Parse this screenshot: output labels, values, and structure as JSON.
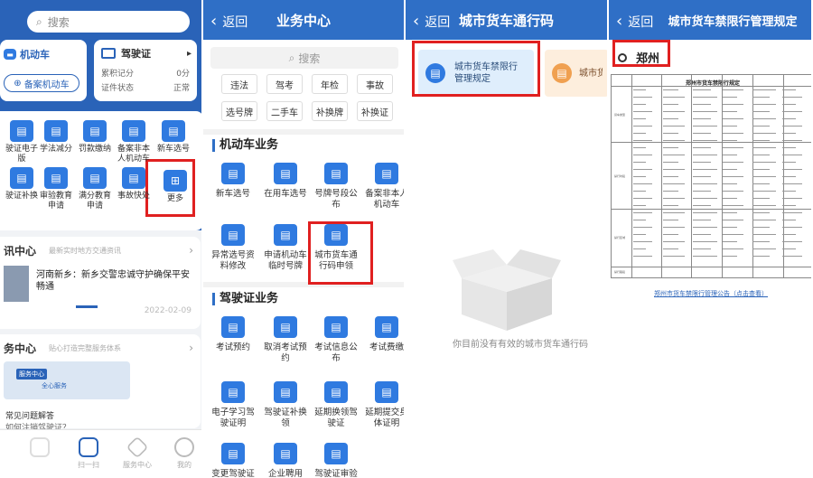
{
  "screen1": {
    "search_placeholder": "搜索",
    "vehicle_label": "机动车",
    "register_vehicle": "备案机动车",
    "license_label": "驾驶证",
    "points_label": "累积记分",
    "points_value": "0分",
    "status_label": "证件状态",
    "status_value": "正常",
    "grid": [
      "驶证电子版",
      "学法减分",
      "罚款缴纳",
      "备案非本人机动车",
      "新车选号",
      "驶证补换",
      "审验教育申请",
      "满分教育申请",
      "事故快处",
      "更多"
    ],
    "news_title": "讯中心",
    "news_sub": "最新实时地方交通资讯",
    "news_item": "河南新乡：新乡交警忠诚守护确保平安畅通",
    "news_date": "2022-02-09",
    "service_title": "务中心",
    "service_sub": "贴心打造完整服务体系",
    "service_badge": "服务中心",
    "service_badge2": "全心服务",
    "faq": "常见问题解答",
    "faq2": "如何注销驾驶证？",
    "tabs": [
      "",
      "扫一扫",
      "服务中心",
      "我的"
    ]
  },
  "screen2": {
    "back": "返回",
    "title": "业务中心",
    "search_placeholder": "搜索",
    "chips": [
      "违法",
      "驾考",
      "年检",
      "事故",
      "选号牌",
      "二手车",
      "补换牌",
      "补换证"
    ],
    "section_vehicle": "机动车业务",
    "vehicle_items": [
      "新车选号",
      "在用车选号",
      "号牌号段公布",
      "备案非本人机动车",
      "异常选号资料修改",
      "申请机动车临时号牌",
      "城市货车通行码申领"
    ],
    "section_license": "驾驶证业务",
    "license_items": [
      "考试预约",
      "取消考试预约",
      "考试信息公布",
      "考试费缴",
      "电子学习驾驶证明",
      "驾驶证补换领",
      "延期换领驾驶证",
      "延期提交身体证明",
      "变更驾驶证",
      "企业聘用",
      "驾驶证审验"
    ]
  },
  "screen3": {
    "back": "返回",
    "title": "城市货车通行码",
    "card1": "城市货车禁限行管理规定",
    "card2": "城市货车通行码申领",
    "empty_text": "你目前没有有效的城市货车通行码"
  },
  "screen4": {
    "back": "返回",
    "title": "城市货车禁限行管理规定",
    "city": "郑州",
    "table_title": "郑州市货车禁限行规定",
    "row_labels": [
      "货车类型",
      "禁行时段",
      "禁行区域",
      "禁行路段"
    ],
    "link": "郑州市货车禁限行管理公告（点击查看）"
  }
}
